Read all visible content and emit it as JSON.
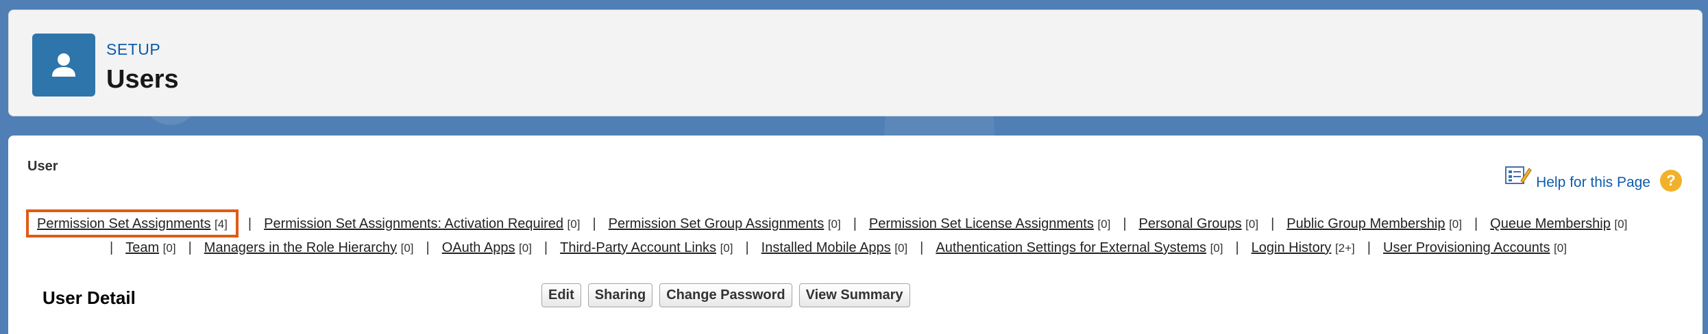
{
  "header": {
    "setup_label": "SETUP",
    "title": "Users",
    "icon": "user-icon"
  },
  "section": {
    "label": "User"
  },
  "help": {
    "link_text": "Help for this Page",
    "icon": "help-page-icon",
    "question_glyph": "?"
  },
  "related_links": {
    "line1": [
      {
        "label": "Permission Set Assignments",
        "count": "[4]",
        "highlighted": true
      },
      {
        "label": "Permission Set Assignments: Activation Required",
        "count": "[0]"
      },
      {
        "label": "Permission Set Group Assignments",
        "count": "[0]"
      },
      {
        "label": "Permission Set License Assignments",
        "count": "[0]"
      },
      {
        "label": "Personal Groups",
        "count": "[0]"
      },
      {
        "label": "Public Group Membership",
        "count": "[0]"
      },
      {
        "label": "Queue Membership",
        "count": "[0]"
      }
    ],
    "line2": [
      {
        "label": "Team",
        "count": "[0]"
      },
      {
        "label": "Managers in the Role Hierarchy",
        "count": "[0]"
      },
      {
        "label": "OAuth Apps",
        "count": "[0]"
      },
      {
        "label": "Third-Party Account Links",
        "count": "[0]"
      },
      {
        "label": "Installed Mobile Apps",
        "count": "[0]"
      },
      {
        "label": "Authentication Settings for External Systems",
        "count": "[0]"
      },
      {
        "label": "Login History",
        "count": "[2+]"
      },
      {
        "label": "User Provisioning Accounts",
        "count": "[0]"
      }
    ],
    "separator": "|"
  },
  "detail": {
    "title": "User Detail",
    "buttons": {
      "edit": "Edit",
      "sharing": "Sharing",
      "change_password": "Change Password",
      "view_summary": "View Summary"
    }
  },
  "colors": {
    "brand_blue": "#2e75ab",
    "link_blue": "#0b5cab",
    "highlight": "#e05a16",
    "help_orange": "#f1b12a"
  }
}
